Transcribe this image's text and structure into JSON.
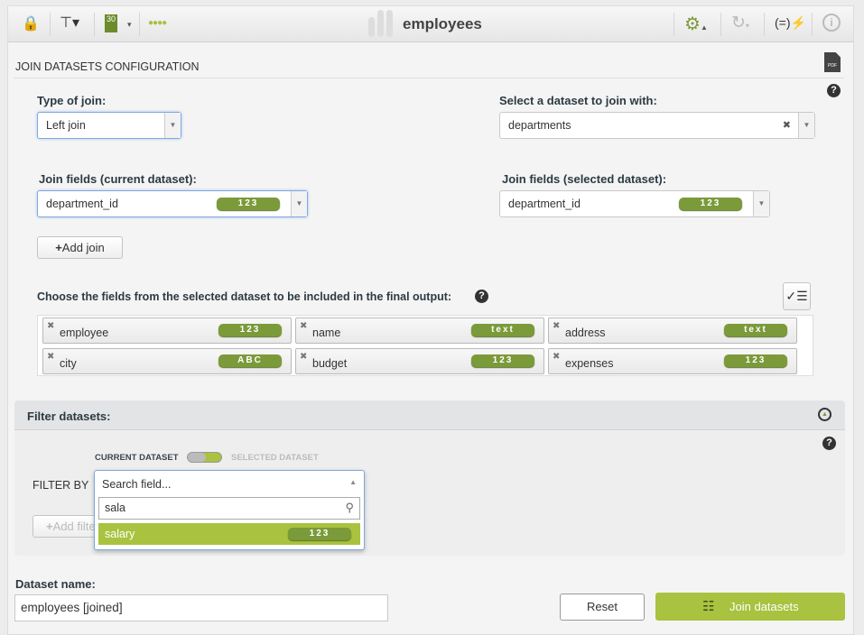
{
  "toolbar": {
    "title": "employees",
    "icons": [
      "lock-icon",
      "dataset-tree-icon",
      "sample-icon",
      "progress-dots-icon",
      "logo-bars-icon",
      "gear-icon",
      "reload-icon",
      "formula-icon",
      "info-icon"
    ]
  },
  "section_title": "JOIN DATASETS CONFIGURATION",
  "type_of_join": {
    "label": "Type of join:",
    "value": "Left join"
  },
  "dataset_select": {
    "label": "Select a dataset to join with:",
    "value": "departments"
  },
  "join_fields_current": {
    "label": "Join fields (current dataset):",
    "value": "department_id",
    "type": "123"
  },
  "join_fields_selected": {
    "label": "Join fields (selected dataset):",
    "value": "department_id",
    "type": "123"
  },
  "add_join": "Add join",
  "fields_label": "Choose the fields from the selected dataset to be included in the final output:",
  "fields": [
    {
      "name": "employee",
      "type": "123"
    },
    {
      "name": "name",
      "type": "text"
    },
    {
      "name": "address",
      "type": "text"
    },
    {
      "name": "city",
      "type": "ABC"
    },
    {
      "name": "budget",
      "type": "123"
    },
    {
      "name": "expenses",
      "type": "123"
    }
  ],
  "filter": {
    "title": "Filter datasets:",
    "current": "CURRENT DATASET",
    "selected": "SELECTED DATASET",
    "filter_by": "FILTER BY",
    "placeholder": "Search field...",
    "search_value": "sala",
    "result": {
      "name": "salary",
      "type": "123"
    },
    "add_filter": "Add filter"
  },
  "dataset_name": {
    "label": "Dataset name:",
    "value": "employees [joined]"
  },
  "reset": "Reset",
  "join_button": "Join datasets",
  "colors": {
    "accent": "#a9c23f",
    "badge": "#7b9a3a"
  }
}
